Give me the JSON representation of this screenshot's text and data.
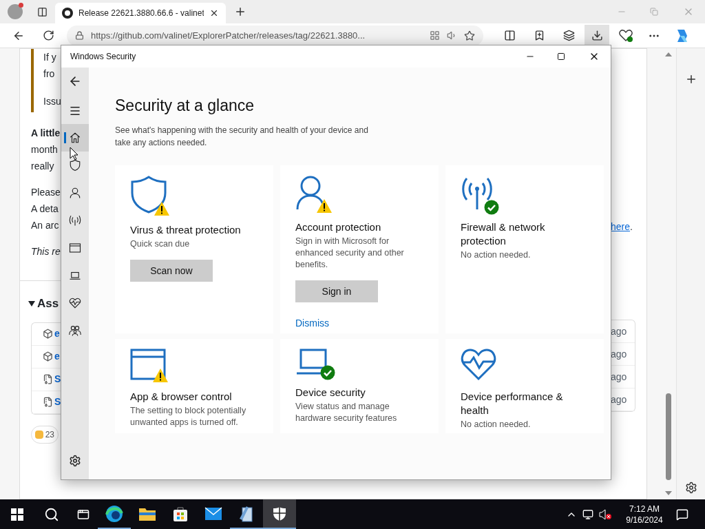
{
  "browser": {
    "tab": {
      "title": "Release 22621.3880.66.6 - valinet"
    },
    "url": "https://github.com/valinet/ExplorerPatcher/releases/tag/22621.3880...",
    "page": {
      "quote_lines": [
        "If y",
        "fro",
        "Issu"
      ],
      "paragraphs": [
        {
          "lines": [
            {
              "kind": "bold",
              "text": "A little"
            },
            {
              "kind": "plain",
              "text": "month"
            },
            {
              "kind": "plain",
              "text": "really"
            }
          ]
        },
        {
          "lines": [
            {
              "kind": "plain",
              "text": "Please"
            },
            {
              "kind": "plain",
              "text": "A deta"
            },
            {
              "kind": "plain",
              "text": "An arc"
            }
          ]
        },
        {
          "lines": [
            {
              "kind": "italic",
              "text": "This re"
            }
          ]
        }
      ],
      "link": {
        "text": "here",
        "suffix": "."
      },
      "assets": {
        "title": "Ass",
        "expanded": true,
        "rows": [
          {
            "kind": "package",
            "name": "e",
            "time": "ago"
          },
          {
            "kind": "package",
            "name": "e",
            "time": "ago"
          },
          {
            "kind": "archive",
            "name": "S",
            "time": "ago"
          },
          {
            "kind": "archive",
            "name": "S",
            "time": "ago"
          }
        ]
      },
      "reaction": {
        "count": "23"
      }
    }
  },
  "window": {
    "title": "Windows Security",
    "nav": [
      {
        "kind": "home",
        "selected": true
      },
      {
        "kind": "shield",
        "selected": false
      },
      {
        "kind": "person",
        "selected": false
      },
      {
        "kind": "antenna",
        "selected": false
      },
      {
        "kind": "window",
        "selected": false
      },
      {
        "kind": "laptop",
        "selected": false
      },
      {
        "kind": "heart",
        "selected": false
      },
      {
        "kind": "family",
        "selected": false
      }
    ],
    "heading": "Security at a glance",
    "subtitle": "See what's happening with the security and health of your device and take any actions needed.",
    "cards": [
      {
        "kind": "shield",
        "warning": true,
        "healthy": false,
        "title": "Virus & threat protection",
        "description": "Quick scan due",
        "actions": [
          {
            "kind": "button",
            "label": "Scan now"
          }
        ]
      },
      {
        "kind": "person",
        "warning": true,
        "healthy": false,
        "title": "Account protection",
        "description": "Sign in with Microsoft for enhanced security and other benefits.",
        "actions": [
          {
            "kind": "button",
            "label": "Sign in"
          },
          {
            "kind": "link",
            "label": "Dismiss"
          }
        ]
      },
      {
        "kind": "antenna",
        "warning": false,
        "healthy": true,
        "title": "Firewall & network protection",
        "description": "No action needed."
      },
      {
        "kind": "window",
        "warning": true,
        "healthy": false,
        "title": "App & browser control",
        "description": "The setting to block potentially unwanted apps is turned off."
      },
      {
        "kind": "laptop",
        "warning": false,
        "healthy": true,
        "title": "Device security",
        "description": "View status and manage hardware security features"
      },
      {
        "kind": "heart",
        "warning": false,
        "healthy": false,
        "title": "Device performance & health",
        "description": "No action needed."
      }
    ]
  },
  "taskbar": {
    "apps": [
      {
        "kind": "edge",
        "running": true,
        "selected": false
      },
      {
        "kind": "explorer",
        "running": false,
        "selected": false
      },
      {
        "kind": "store",
        "running": false,
        "selected": false
      },
      {
        "kind": "mail",
        "running": false,
        "selected": false
      },
      {
        "kind": "tool",
        "running": true,
        "selected": false
      },
      {
        "kind": "security",
        "running": true,
        "selected": true
      }
    ],
    "time": "7:12 AM",
    "date": "9/16/2024"
  }
}
